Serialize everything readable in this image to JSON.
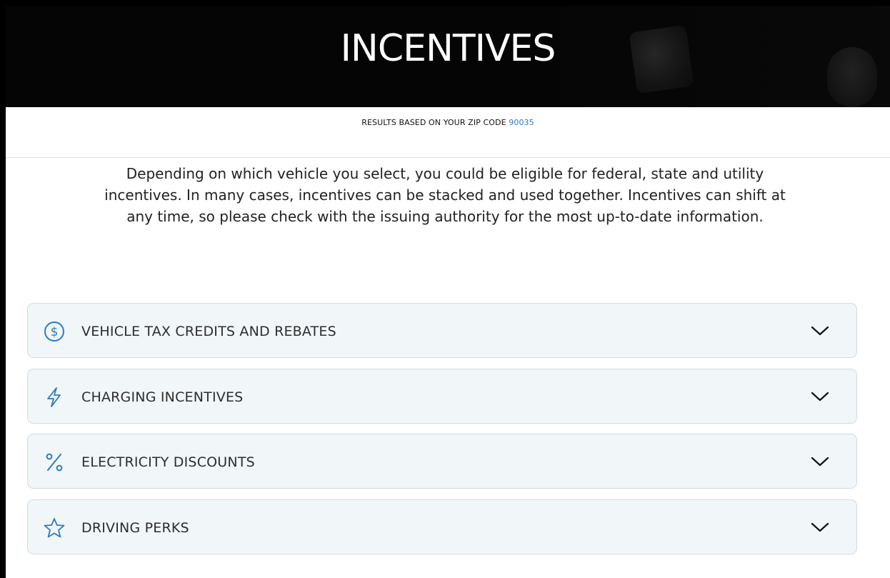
{
  "header": {
    "title": "INCENTIVES"
  },
  "zip": {
    "prefix": "RESULTS BASED ON YOUR ZIP CODE",
    "value": "90035"
  },
  "intro": {
    "text": "Depending on which vehicle you select, you could be eligible for federal, state and utility incentives. In many cases, incentives can be stacked and used together. Incentives can shift at any time, so please check with the issuing authority for the most up-to-date information."
  },
  "categories": [
    {
      "label": "VEHICLE TAX CREDITS AND REBATES",
      "icon": "dollar-circle-icon",
      "expanded": false
    },
    {
      "label": "CHARGING INCENTIVES",
      "icon": "lightning-bolt-icon",
      "expanded": false
    },
    {
      "label": "ELECTRICITY DISCOUNTS",
      "icon": "percent-icon",
      "expanded": false
    },
    {
      "label": "DRIVING PERKS",
      "icon": "star-icon",
      "expanded": false
    }
  ],
  "colors": {
    "accent": "#2e7bbf",
    "panel_background": "#f1f6f9",
    "panel_border": "#d2dbe2",
    "hero_background": "#050505"
  }
}
